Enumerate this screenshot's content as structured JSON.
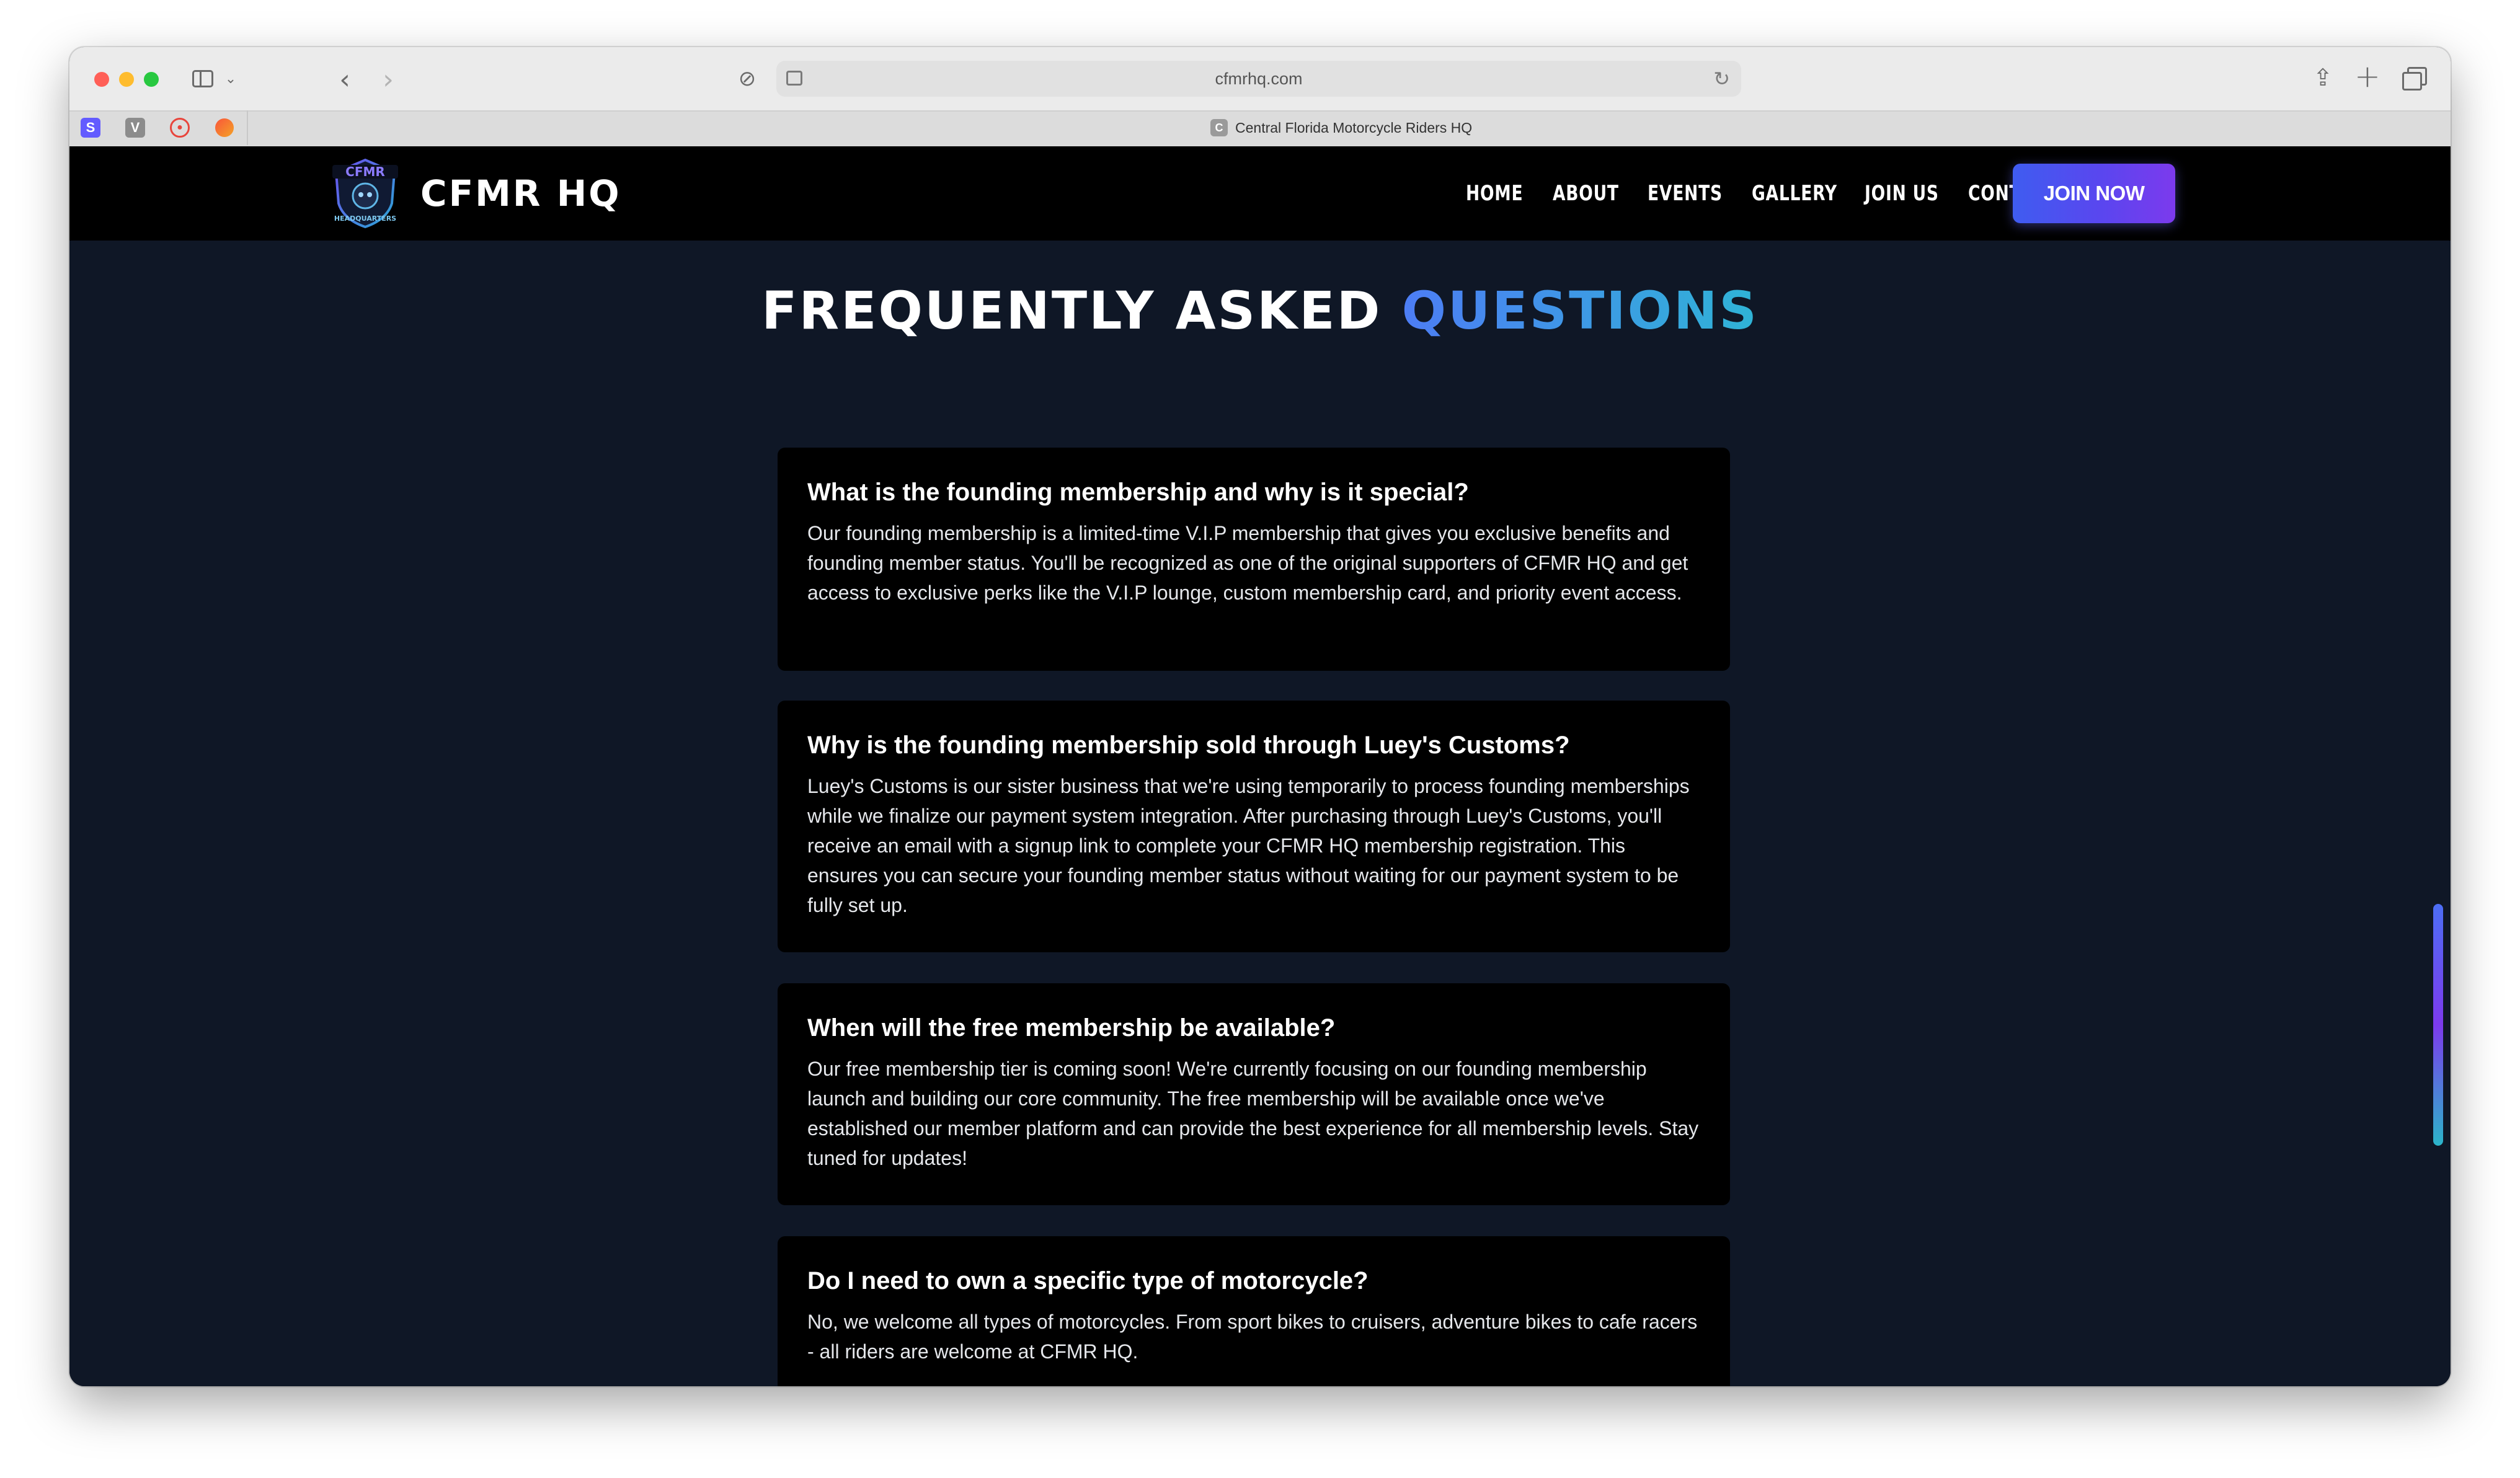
{
  "browser": {
    "address": "cfmrhq.com",
    "active_tab_title": "Central Florida Motorcycle Riders HQ",
    "active_tab_favicon": "C",
    "pinned_tabs": [
      {
        "icon": "stripe-icon",
        "glyph": "S"
      },
      {
        "icon": "v-icon",
        "glyph": "V"
      },
      {
        "icon": "target-icon",
        "glyph": ""
      },
      {
        "icon": "orange-circle-icon",
        "glyph": ""
      }
    ]
  },
  "site": {
    "logo_text_top": "CFMR",
    "logo_text_bottom": "HEADQUARTERS",
    "brand": "CFMR HQ",
    "nav": [
      "HOME",
      "ABOUT",
      "EVENTS",
      "GALLERY",
      "JOIN US",
      "CONTACT"
    ],
    "cta": "JOIN NOW",
    "accent_gradient": [
      "#4d7df5",
      "#2fb4d6"
    ],
    "button_gradient": [
      "#3f5cf0",
      "#7c3aed"
    ]
  },
  "faq": {
    "title_main": "FREQUENTLY ASKED ",
    "title_accent": "QUESTIONS",
    "items": [
      {
        "question": "What is the founding membership and why is it special?",
        "answer": "Our founding membership is a limited-time V.I.P membership that gives you exclusive benefits and founding member status. You'll be recognized as one of the original supporters of CFMR HQ and get access to exclusive perks like the V.I.P lounge, custom membership card, and priority event access."
      },
      {
        "question": "Why is the founding membership sold through Luey's Customs?",
        "answer": "Luey's Customs is our sister business that we're using temporarily to process founding memberships while we finalize our payment system integration. After purchasing through Luey's Customs, you'll receive an email with a signup link to complete your CFMR HQ membership registration. This ensures you can secure your founding member status without waiting for our payment system to be fully set up."
      },
      {
        "question": "When will the free membership be available?",
        "answer": "Our free membership tier is coming soon! We're currently focusing on our founding membership launch and building our core community. The free membership will be available once we've established our member platform and can provide the best experience for all membership levels. Stay tuned for updates!"
      },
      {
        "question": "Do I need to own a specific type of motorcycle?",
        "answer": "No, we welcome all types of motorcycles. From sport bikes to cruisers, adventure bikes to cafe racers - all riders are welcome at CFMR HQ."
      }
    ]
  }
}
